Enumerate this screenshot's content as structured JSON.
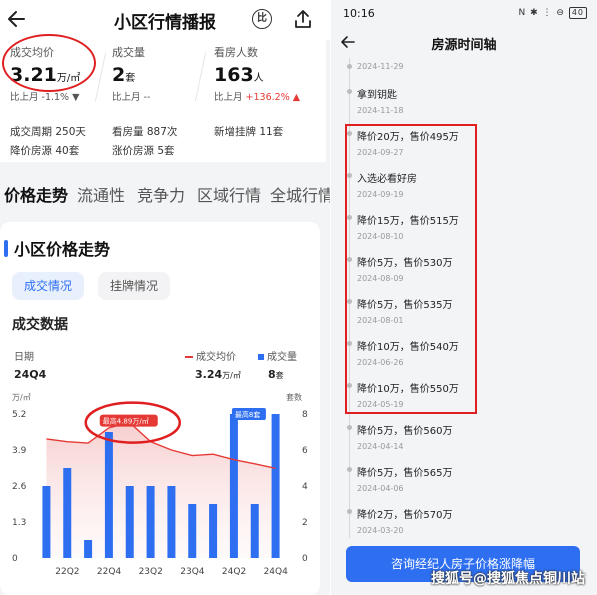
{
  "left": {
    "title": "小区行情播报",
    "compare_label": "比",
    "stats": {
      "avg_price": {
        "label": "成交均价",
        "value": "3.21",
        "unit": "万/㎡",
        "sub": "比上月 -1.1% ▼"
      },
      "deals": {
        "label": "成交量",
        "value": "2",
        "unit": "套",
        "sub": "比上月 --"
      },
      "viewers": {
        "label": "看房人数",
        "value": "163",
        "unit": "人",
        "sub_prefix": "比上月 ",
        "sub_change": "+136.2% ▲"
      }
    },
    "info": {
      "cycle": "成交周期 250天",
      "views": "看房量 887次",
      "new_listings": "新增挂牌 11套",
      "price_cut": "降价房源 40套",
      "price_up": "涨价房源 5套"
    },
    "tabs": [
      "价格走势",
      "流通性",
      "竞争力",
      "区域行情",
      "全城行情"
    ],
    "trend": {
      "title": "小区价格走势",
      "subtabs": [
        "成交情况",
        "挂牌情况"
      ],
      "deal_title": "成交数据",
      "legend": {
        "date_label": "日期",
        "date_value": "24Q4",
        "price_label": "成交均价",
        "price_value": "3.24",
        "price_unit": "万/㎡",
        "count_label": "成交量",
        "count_value": "8",
        "count_unit": "套"
      }
    }
  },
  "chart_data": {
    "type": "bar",
    "left_unit": "万/㎡",
    "right_unit": "套数",
    "y_left_ticks": [
      "5.2",
      "3.9",
      "2.6",
      "1.3",
      "0"
    ],
    "y_right_ticks": [
      "8",
      "6",
      "4",
      "2",
      "0"
    ],
    "ylim_left": [
      0,
      5.2
    ],
    "ylim_right": [
      0,
      8
    ],
    "x_tick_labels": [
      "22Q2",
      "22Q4",
      "23Q2",
      "23Q4",
      "24Q2",
      "24Q4"
    ],
    "series": [
      {
        "name": "成交量",
        "values": [
          4,
          5,
          1,
          7,
          4,
          4,
          4,
          3,
          3,
          8,
          3,
          8
        ]
      },
      {
        "name": "成交均价",
        "values": [
          4.3,
          4.2,
          4.15,
          4.7,
          4.89,
          4.2,
          3.9,
          3.7,
          3.75,
          3.55,
          3.4,
          3.24
        ]
      }
    ],
    "annotations": {
      "max_price": "最高4.89万/㎡",
      "max_count": "最高8套"
    },
    "colors": {
      "bar": "#2e6ff2",
      "line": "#e53935"
    }
  },
  "right": {
    "status": {
      "time": "10:16",
      "icons": "N ✱ ⋮ ⊖",
      "battery": "40"
    },
    "title": "房源时间轴",
    "timeline": [
      {
        "text": "",
        "date": "2024-11-29"
      },
      {
        "text": "拿到钥匙",
        "date": "2024-11-18"
      },
      {
        "text": "降价20万，售价495万",
        "date": "2024-09-27"
      },
      {
        "text": "入选必看好房",
        "date": "2024-09-19"
      },
      {
        "text": "降价15万，售价515万",
        "date": "2024-08-10"
      },
      {
        "text": "降价5万，售价530万",
        "date": "2024-08-09"
      },
      {
        "text": "降价5万，售价535万",
        "date": "2024-08-01"
      },
      {
        "text": "降价10万，售价540万",
        "date": "2024-06-26"
      },
      {
        "text": "降价10万，售价550万",
        "date": "2024-05-19"
      },
      {
        "text": "降价5万，售价560万",
        "date": "2024-04-14"
      },
      {
        "text": "降价5万，售价565万",
        "date": "2024-04-06"
      },
      {
        "text": "降价2万，售价570万",
        "date": "2024-03-20"
      }
    ],
    "cta": "咨询经纪人房子价格涨降幅",
    "watermark": "搜狐号@搜狐焦点铜川站"
  }
}
